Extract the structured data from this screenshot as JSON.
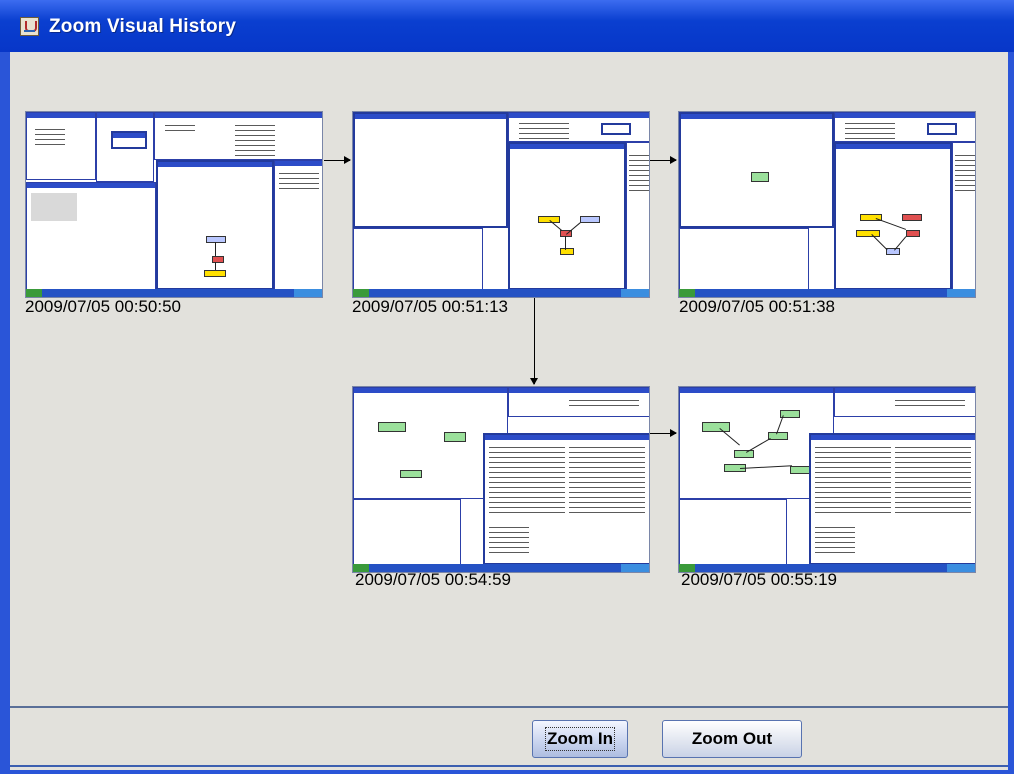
{
  "window": {
    "title": "Zoom Visual History",
    "icon": "java-cup-icon"
  },
  "history": {
    "snapshots": [
      {
        "timestamp": "2009/07/05 00:50:50"
      },
      {
        "timestamp": "2009/07/05 00:51:13"
      },
      {
        "timestamp": "2009/07/05 00:51:38"
      },
      {
        "timestamp": "2009/07/05 00:54:59"
      },
      {
        "timestamp": "2009/07/05 00:55:19"
      }
    ]
  },
  "buttons": {
    "zoom_in": "Zoom In",
    "zoom_out": "Zoom Out"
  },
  "colors": {
    "titlebar": "#0a3fd0",
    "background": "#e2e1dc",
    "node_yellow": "#ffe000",
    "node_green": "#9be09b",
    "node_blue": "#b9c7ff",
    "node_red": "#e05050"
  }
}
